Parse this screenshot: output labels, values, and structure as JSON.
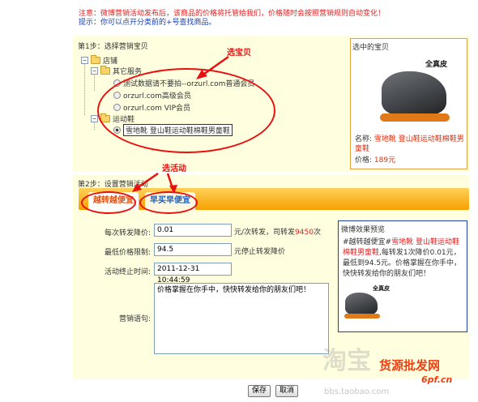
{
  "notice": {
    "line1": "注意：微博营销活动发布后，该商品的价格将托管给我们，价格随时会按照营销规则自动变化！",
    "line2": "提示：你可以点开分类前的+号查找商品。"
  },
  "step1": {
    "label": "第1步：选择营销宝贝",
    "annotation": "选宝贝",
    "tree": {
      "root": "店铺",
      "category1": "其它服务",
      "item1": "测试数据请不要拍--orzurl.com普通会员",
      "item2": "orzurl.com高级会员",
      "item3": "orzurl.com VIP会员",
      "category2": "运动鞋",
      "item4": "雪地靴 登山鞋运动鞋棉鞋男童鞋"
    }
  },
  "selected": {
    "title": "选中的宝贝",
    "brand": "全真皮",
    "name_label": "名称:",
    "name_value": "雪地靴 登山鞋运动鞋棉鞋男童鞋",
    "price_label": "价格:",
    "price_value": "189元"
  },
  "step2": {
    "label": "第2步：设置营销活动",
    "annotation": "选活动",
    "tab_active": "越转越便宜",
    "tab_inactive": "早买早便宜"
  },
  "form": {
    "reduce_label": "每次转发降价:",
    "reduce_value": "0.01",
    "reduce_hint_pre": "元/次转发，司转发",
    "reduce_hint_num": "9450",
    "reduce_hint_post": "次",
    "min_label": "最低价格限制:",
    "min_value": "94.5",
    "min_hint": "元停止转发降价",
    "end_label": "活动终止时间:",
    "end_value": "2011-12-31 10:44:59",
    "slogan_label": "营销语句:",
    "slogan_value": "价格掌握在你手中，快快转发给你的朋友们吧！"
  },
  "preview": {
    "title": "微博效果预览",
    "tag": "#越转越便宜#",
    "product": "雪地靴 登山鞋运动鞋棉鞋男童鞋",
    "text": ",每转发1次降价0.01元，最低到94.5元。价格掌握在你手中，快快转发给你的朋友们吧！",
    "brand": "全真皮"
  },
  "buttons": {
    "save": "保存",
    "cancel": "取消"
  },
  "watermark": {
    "left": "淘宝",
    "right": "货源批发网",
    "url1": "6pf.cn",
    "url2": "bbs.taobao.com"
  },
  "colors": {
    "accent_red": "#e81010",
    "panel_bg": "#ffffe0",
    "tab_orange": "#f7a000"
  }
}
